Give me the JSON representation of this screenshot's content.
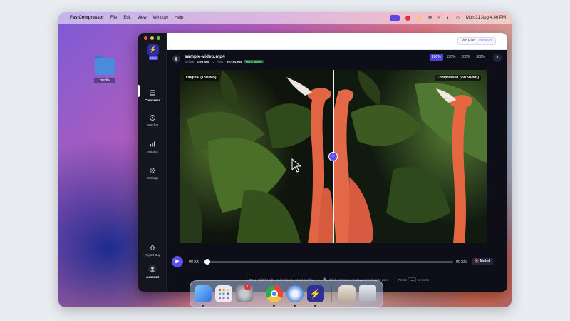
{
  "menubar": {
    "app_name": "FastCompressor",
    "menus": [
      "File",
      "Edit",
      "View",
      "Window",
      "Help"
    ],
    "clock": "Mon 31 Aug  4:46 PM"
  },
  "desktop": {
    "folder_label": "media"
  },
  "app": {
    "logo_badge": "PRO",
    "plan": {
      "label": "Pro Plan",
      "sub": "Unlimited"
    },
    "sidebar": {
      "items": [
        {
          "label": "Compress"
        },
        {
          "label": "Watcher"
        },
        {
          "label": "Insights"
        },
        {
          "label": "Settings"
        },
        {
          "label": "Report Bug"
        },
        {
          "label": "Account"
        }
      ]
    },
    "file": {
      "name": "sample-video.mp4",
      "before_label": "Before:",
      "before_value": "1.98 MB",
      "arrow": "→",
      "after_label": "After:",
      "after_value": "997.94 KB",
      "saved": "+51% Saved"
    },
    "zoom": {
      "options": [
        "100%",
        "150%",
        "200%",
        "300%"
      ],
      "active": "100%"
    },
    "close_symbol": "✕",
    "viewer": {
      "label_original": "Original (1.98 MB)",
      "label_compressed": "Compressed (997.94 KB)",
      "handle_symbol": "‹›"
    },
    "player": {
      "play_symbol": "▶",
      "time_current": "00:00",
      "time_total": "00:06",
      "progress": 0.0,
      "mute_label": "Muted"
    },
    "hints": {
      "drag": "↔ Drag split handle to compare visual quality",
      "zoom": "🔍 Click zoom percentages or drag to pan",
      "close_prefix": "Press",
      "close_key": "esc",
      "close_suffix": "to close"
    }
  },
  "dock": {
    "apps": [
      "Finder",
      "Launchpad",
      "System Settings",
      "Chrome",
      "Safari",
      "FastCompressor",
      "Preview",
      "Trash"
    ],
    "settings_badge": "1"
  },
  "colors": {
    "accent": "#5b4ff0",
    "window_bg": "#0d0e18",
    "sidebar_bg": "#14151f",
    "saved_green": "#8df0b1"
  }
}
